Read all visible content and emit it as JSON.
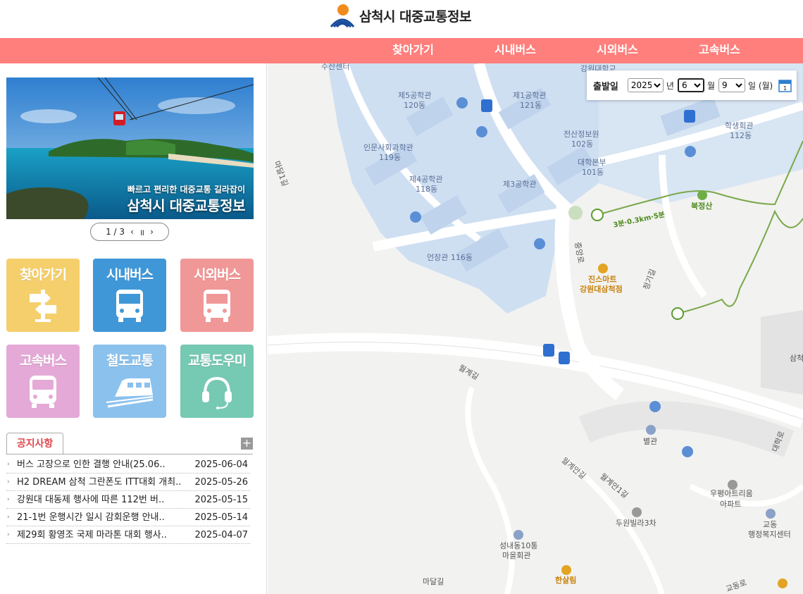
{
  "header": {
    "logo_text": "삼척시 대중교통정보"
  },
  "nav": {
    "items": [
      "찾아가기",
      "시내버스",
      "시외버스",
      "고속버스"
    ]
  },
  "banner": {
    "line1": "빠르고 편리한 대중교통 길라잡이",
    "line2": "삼척시 대중교통정보",
    "pager": "1 / 3"
  },
  "tiles": [
    {
      "label": "찾아가기",
      "color": "#f5cf6c",
      "icon": "signpost-icon"
    },
    {
      "label": "시내버스",
      "color": "#3f97d8",
      "icon": "bus-icon"
    },
    {
      "label": "시외버스",
      "color": "#f09897",
      "icon": "bus-icon"
    },
    {
      "label": "고속버스",
      "color": "#e4a9d6",
      "icon": "express-bus-icon"
    },
    {
      "label": "철도교통",
      "color": "#8bc1ed",
      "icon": "train-icon"
    },
    {
      "label": "교통도우미",
      "color": "#76c9b3",
      "icon": "headset-icon"
    }
  ],
  "notice": {
    "tab": "공지사항",
    "more": "+",
    "items": [
      {
        "title": "버스 고장으로 인한 결행 안내(25.06..",
        "date": "2025-06-04"
      },
      {
        "title": "H2 DREAM 삼척 그란폰도 ITT대회 개최..",
        "date": "2025-05-26"
      },
      {
        "title": "강원대 대동제 행사에 따른 112번 버..",
        "date": "2025-05-15"
      },
      {
        "title": "21-1번 운행시간 일시 감회운행 안내..",
        "date": "2025-05-14"
      },
      {
        "title": "제29회 황영조 국제 마라톤 대회 행사..",
        "date": "2025-04-07"
      }
    ]
  },
  "date_panel": {
    "label": "출발일",
    "year": "2025",
    "year_unit": "년",
    "month": "6",
    "month_unit": "월",
    "day": "9",
    "day_unit": "일 (월)"
  },
  "map": {
    "labels": [
      "수산센터",
      "강원대학교",
      "제5공학관",
      "120동",
      "제1공학관",
      "121동",
      "인문사회과학관",
      "119동",
      "전산정보원",
      "102동",
      "대학본부",
      "101동",
      "학생회관",
      "112동",
      "제4공학관",
      "118동",
      "제3공학관",
      "마달1길",
      "북정산",
      "3분·0.3km·5분",
      "언장관 116동",
      "중앙로",
      "진스마트",
      "강원대삼척점",
      "정기길",
      "삼척",
      "월계길",
      "별관",
      "대학로",
      "월계안길",
      "월계안1길",
      "우평아트리움",
      "아파트",
      "두원빌라3차",
      "교동",
      "행정복지센터",
      "성내동10통",
      "마을회관",
      "한살림",
      "마달길",
      "교동로"
    ]
  }
}
